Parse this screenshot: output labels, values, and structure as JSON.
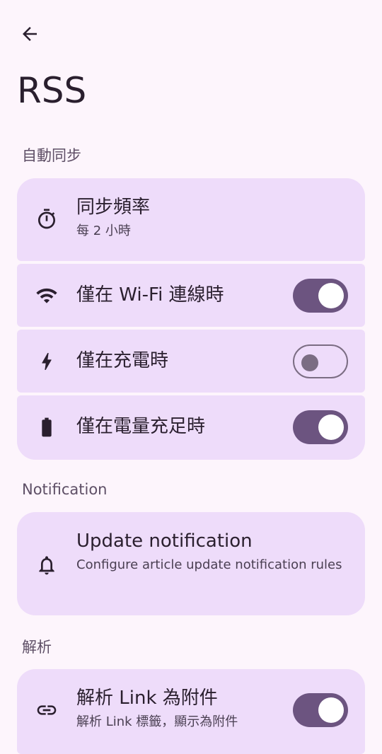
{
  "header": {
    "title": "RSS"
  },
  "sections": {
    "auto_sync": {
      "header": "自動同步"
    },
    "notification": {
      "header": "Notification"
    },
    "parsing": {
      "header": "解析"
    }
  },
  "items": {
    "sync_frequency": {
      "title": "同步頻率",
      "subtitle": "每 2 小時",
      "icon": "timer-icon"
    },
    "wifi_only": {
      "title": "僅在 Wi-Fi 連線時",
      "icon": "wifi-icon",
      "enabled": true
    },
    "charging_only": {
      "title": "僅在充電時",
      "icon": "bolt-icon",
      "enabled": false
    },
    "battery_ok": {
      "title": "僅在電量充足時",
      "icon": "battery-icon",
      "enabled": true
    },
    "update_notification": {
      "title": "Update notification",
      "subtitle": "Configure article update notification rules",
      "icon": "bell-icon"
    },
    "parse_link": {
      "title": "解析 Link 為附件",
      "subtitle": "解析 Link 標籤，顯示為附件",
      "icon": "link-icon",
      "enabled": true
    }
  },
  "colors": {
    "background": "#fdf5fc",
    "card": "#eedcfa",
    "switch_on": "#6c5480",
    "outline": "#7b6d83"
  }
}
